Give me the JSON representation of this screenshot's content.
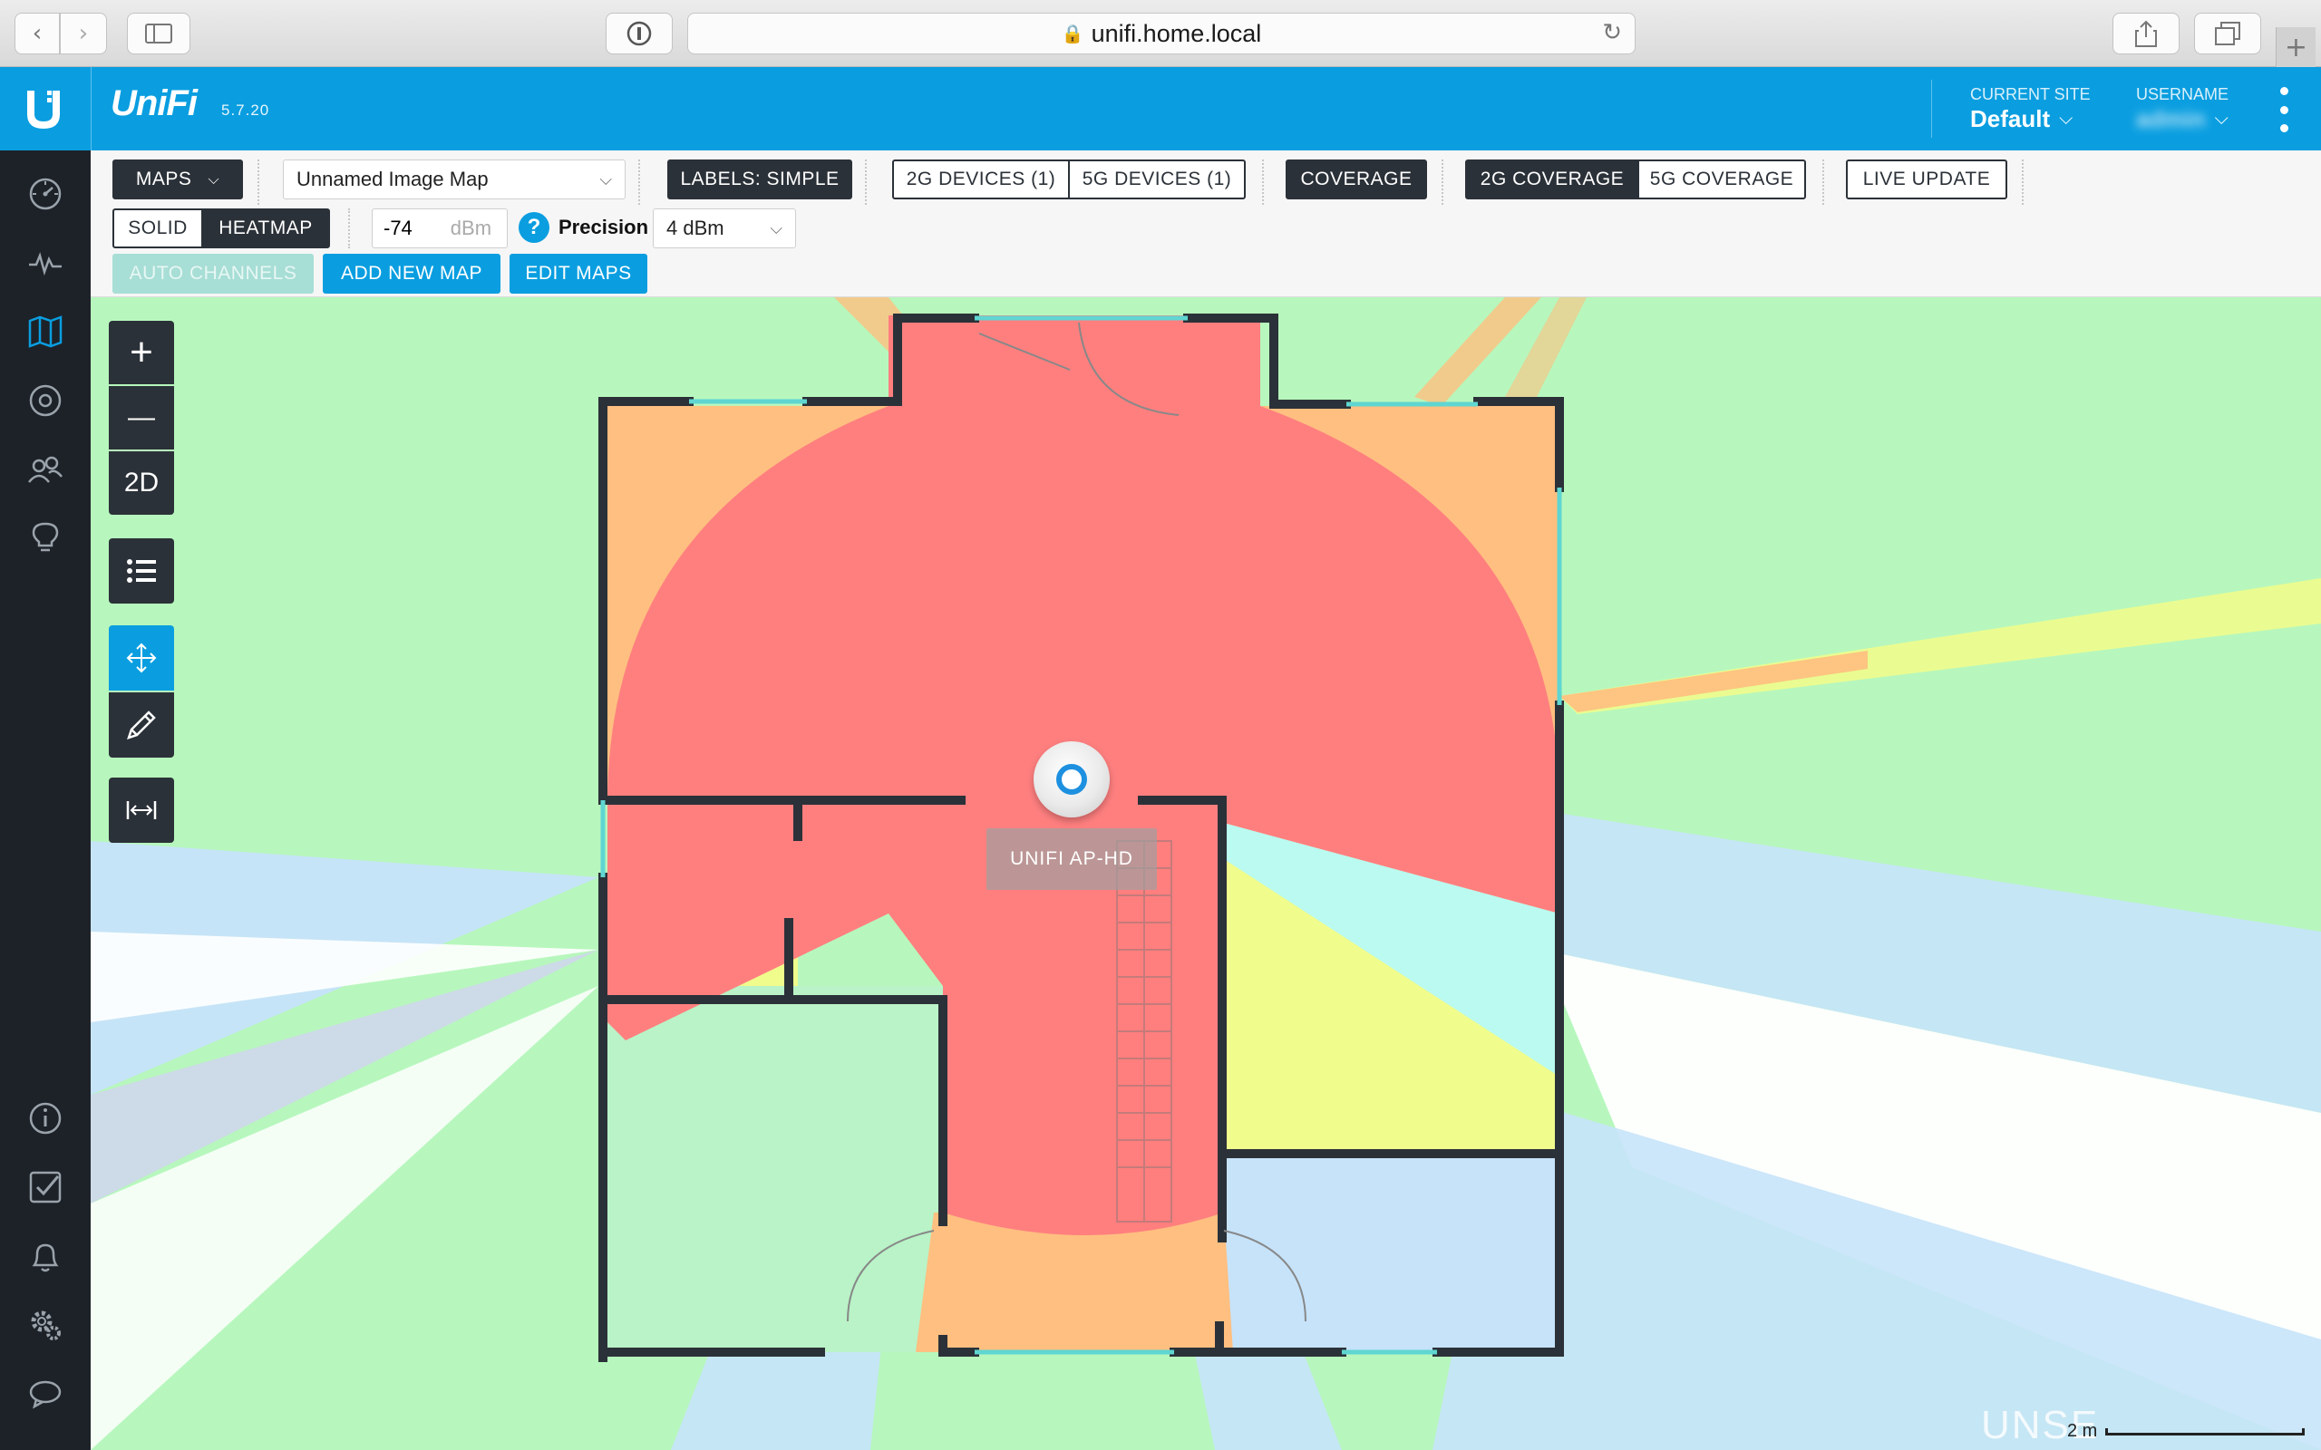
{
  "browser": {
    "url": "unifi.home.local",
    "icons": {
      "back": "chevron-left-icon",
      "forward": "chevron-right-icon",
      "sidebar": "sidebar-icon",
      "reader": "info-icon",
      "reload": "reload-icon",
      "share": "share-icon",
      "tabs": "tabs-icon",
      "new_tab": "plus-icon"
    }
  },
  "header": {
    "brand": "UniFi",
    "version": "5.7.20",
    "site_label": "CURRENT SITE",
    "site_value": "Default",
    "user_label": "USERNAME",
    "user_value": "admin"
  },
  "nav": {
    "items": [
      {
        "id": "dashboard",
        "icon": "dashboard-icon"
      },
      {
        "id": "statistics",
        "icon": "pulse-icon"
      },
      {
        "id": "map",
        "icon": "map-icon",
        "active": true
      },
      {
        "id": "devices",
        "icon": "devices-icon"
      },
      {
        "id": "clients",
        "icon": "clients-icon"
      },
      {
        "id": "insights",
        "icon": "lightbulb-icon"
      },
      {
        "id": "info",
        "icon": "info-icon"
      },
      {
        "id": "tasks",
        "icon": "checkbox-icon"
      },
      {
        "id": "alerts",
        "icon": "bell-icon"
      },
      {
        "id": "settings",
        "icon": "gear-icon"
      },
      {
        "id": "chat",
        "icon": "chat-icon"
      }
    ]
  },
  "toolbar": {
    "maps_label": "MAPS",
    "map_select": "Unnamed Image Map",
    "labels_simple": "LABELS: SIMPLE",
    "devices_2g": "2G DEVICES (1)",
    "devices_5g": "5G DEVICES (1)",
    "coverage": "COVERAGE",
    "coverage_2g": "2G COVERAGE",
    "coverage_5g": "5G COVERAGE",
    "live_update": "LIVE UPDATE",
    "solid": "SOLID",
    "heatmap": "HEATMAP",
    "dbm_value": "-74",
    "dbm_unit": "dBm",
    "precision_label": "Precision",
    "precision_value": "4 dBm",
    "auto_channels": "AUTO CHANNELS",
    "add_new_map": "ADD NEW MAP",
    "edit_maps": "EDIT MAPS"
  },
  "map_controls": {
    "zoom_in": "+",
    "zoom_out": "—",
    "view_mode": "2D"
  },
  "map": {
    "ap_label": "UNIFI AP-HD",
    "scale_label": "2 m",
    "watermark": "UNSE",
    "colors": {
      "strong": "#ff7f7f",
      "good": "#ffbf80",
      "fair": "#f0fc8c",
      "weak": "#b7f7bd",
      "poor": "#bafaf0",
      "edge": "#c6e3fa",
      "accent": "#0a9ee0"
    }
  }
}
